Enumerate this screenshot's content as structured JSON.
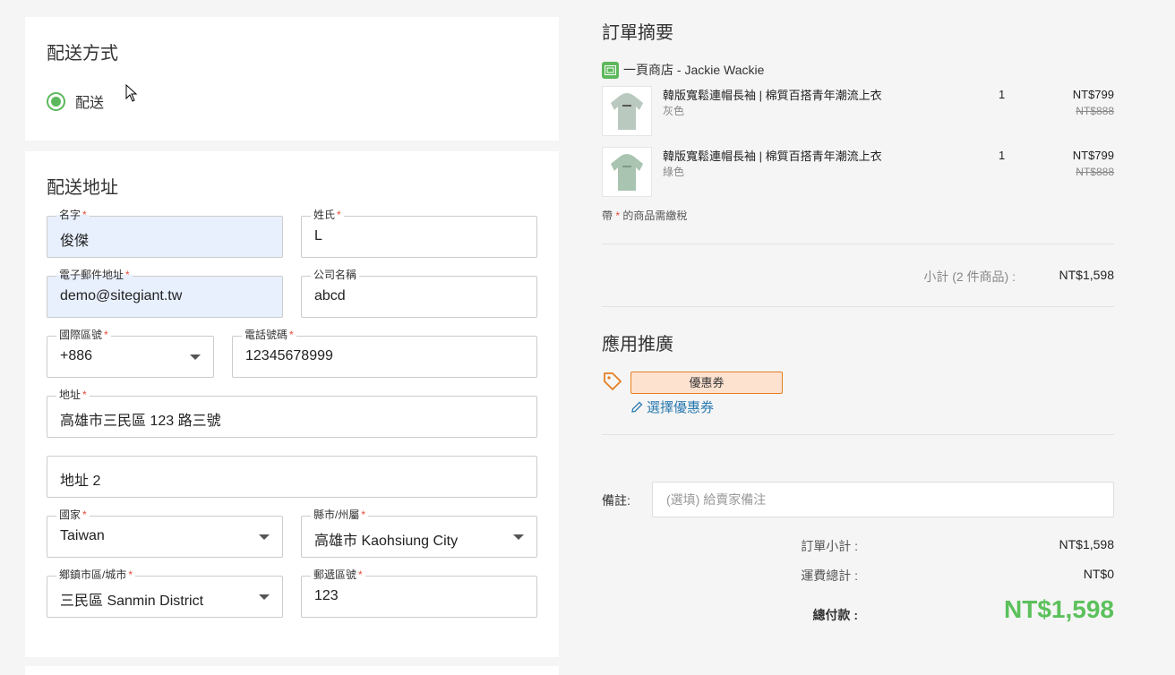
{
  "shipping": {
    "title": "配送方式",
    "option_label": "配送"
  },
  "address": {
    "title": "配送地址",
    "first_name": {
      "label": "名字",
      "value": "俊傑"
    },
    "last_name": {
      "label": "姓氏",
      "value": "L"
    },
    "email": {
      "label": "電子郵件地址",
      "value": "demo@sitegiant.tw"
    },
    "company": {
      "label": "公司名稱",
      "value": "abcd"
    },
    "country_code": {
      "label": "國際區號",
      "value": "+886"
    },
    "phone": {
      "label": "電話號碼",
      "value": "12345678999"
    },
    "address1": {
      "label": "地址",
      "value": "高雄市三民區 123 路三號"
    },
    "address2": {
      "placeholder": "地址 2"
    },
    "country": {
      "label": "國家",
      "value": "Taiwan"
    },
    "state": {
      "label": "縣市/州屬",
      "value": "高雄市 Kaohsiung City"
    },
    "city": {
      "label": "鄉鎮市區/城市",
      "value": "三民區 Sanmin District"
    },
    "postcode": {
      "label": "郵遞區號",
      "value": "123"
    },
    "required_mark": "*"
  },
  "summary": {
    "title": "訂單摘要",
    "store": "一頁商店 - Jackie Wackie",
    "items": [
      {
        "name": "韓版寬鬆連帽長袖 | 棉質百搭青年潮流上衣",
        "variant": "灰色",
        "qty": "1",
        "price": "NT$799",
        "original_price": "NT$888"
      },
      {
        "name": "韓版寬鬆連帽長袖 | 棉質百搭青年潮流上衣",
        "variant": "綠色",
        "qty": "1",
        "price": "NT$799",
        "original_price": "NT$888"
      }
    ],
    "tax_note_prefix": "帶",
    "tax_note_mark": "*",
    "tax_note_suffix": "的商品需繳稅",
    "subtotal_label": "小計 (2 件商品) :",
    "subtotal_value": "NT$1,598"
  },
  "promo": {
    "title": "應用推廣",
    "coupon_badge": "優惠券",
    "select_coupon": "選擇優惠券"
  },
  "note": {
    "label": "備註:",
    "placeholder": "(選填) 給賣家備注"
  },
  "totals": {
    "order_subtotal_label": "訂單小計 :",
    "order_subtotal_value": "NT$1,598",
    "shipping_total_label": "運費總計 :",
    "shipping_total_value": "NT$0",
    "grand_total_label": "總付款 :",
    "grand_total_value": "NT$1,598"
  },
  "colors": {
    "accent_green": "#5cc15c",
    "link_blue": "#2a7ab0",
    "coupon_orange": "#e67e22",
    "autofill_blue": "#e8f0fe"
  }
}
